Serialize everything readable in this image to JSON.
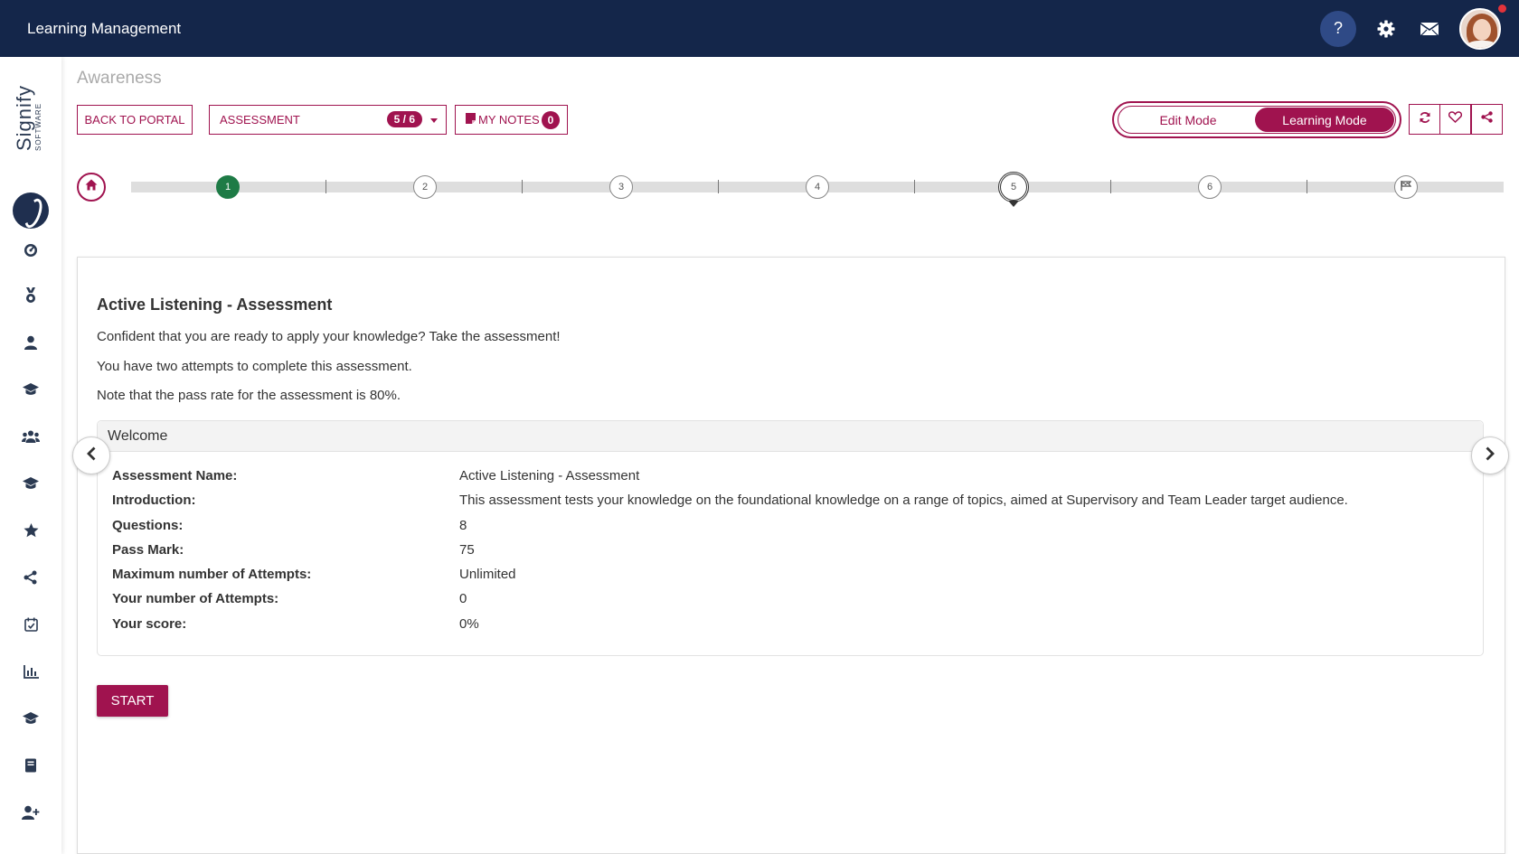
{
  "topbar": {
    "title": "Learning Management",
    "help_label": "?",
    "icons": [
      "gear-icon",
      "mail-icon"
    ]
  },
  "sidebar": {
    "logo_word": "Signify",
    "logo_sub": "SOFTWARE",
    "items": [
      "dashboard-icon",
      "badge-icon",
      "user-icon",
      "graduation-cap-icon",
      "group-icon",
      "graduation-cap-icon",
      "star-icon",
      "share-nodes-icon",
      "calendar-check-icon",
      "bar-chart-icon",
      "graduation-cap-icon",
      "book-icon",
      "user-plus-icon"
    ]
  },
  "page": {
    "heading": "Awareness"
  },
  "toolbar": {
    "back_label": "BACK TO PORTAL",
    "assessment_label": "ASSESSMENT",
    "assessment_badge": "5 / 6",
    "notes_label": "MY NOTES",
    "notes_count": "0",
    "edit_mode": "Edit Mode",
    "learning_mode": "Learning Mode",
    "actions": [
      "refresh-icon",
      "heart-icon",
      "share-icon"
    ]
  },
  "stepper": {
    "steps": [
      "1",
      "2",
      "3",
      "4",
      "5",
      "6"
    ],
    "completed": 1,
    "current": 5,
    "accent": "#a0134f",
    "done_color": "#1e7b46"
  },
  "content": {
    "title": "Active Listening - Assessment",
    "lines": [
      "Confident that you are ready to apply your knowledge? Take the assessment!",
      "You have two attempts to complete this assessment.",
      "Note that the pass rate for the assessment is 80%."
    ],
    "welcome_header": "Welcome",
    "info": [
      {
        "label": "Assessment Name:",
        "value": "Active Listening - Assessment"
      },
      {
        "label": "Introduction:",
        "value": "This assessment tests your knowledge on the foundational knowledge on a range of topics, aimed at Supervisory and Team Leader target audience."
      },
      {
        "label": "Questions:",
        "value": "8"
      },
      {
        "label": "Pass Mark:",
        "value": "75"
      },
      {
        "label": "Maximum number of Attempts:",
        "value": "Unlimited"
      },
      {
        "label": "Your number of Attempts:",
        "value": "0"
      },
      {
        "label": "Your score:",
        "value": "0%"
      }
    ],
    "start_label": "START"
  },
  "colors": {
    "topbar": "#14264a",
    "accent": "#a0134f"
  }
}
